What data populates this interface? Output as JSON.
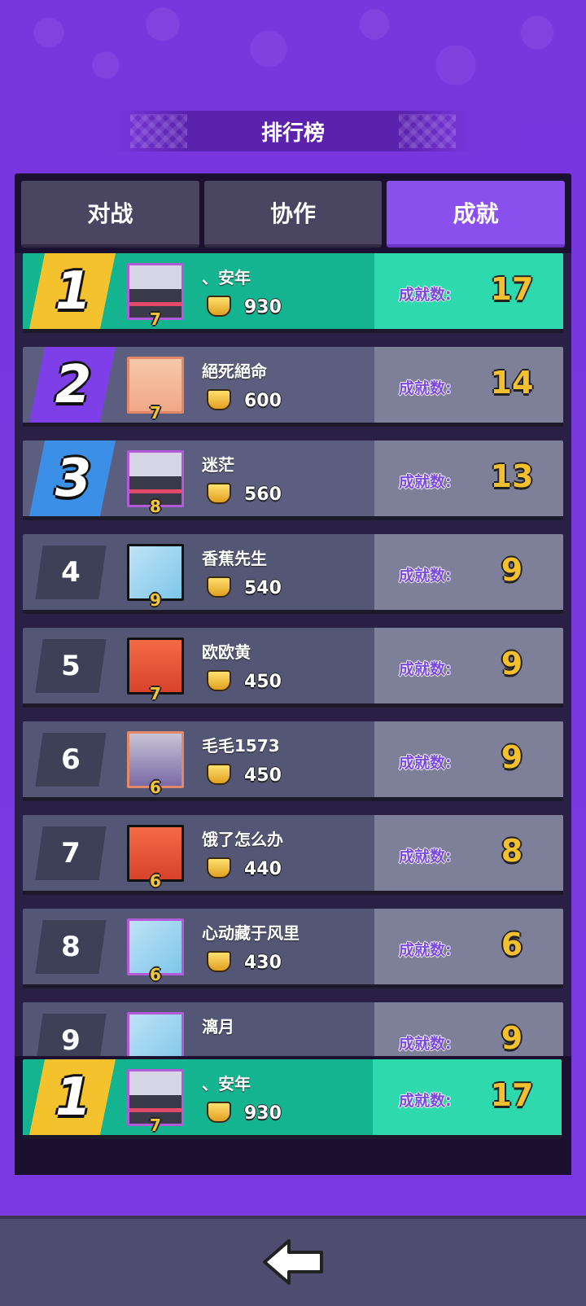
{
  "header": {
    "title": "排行榜"
  },
  "tabs": [
    {
      "label": "对战",
      "active": false
    },
    {
      "label": "协作",
      "active": false
    },
    {
      "label": "成就",
      "active": true
    }
  ],
  "achievement_label": "成就数:",
  "rows": [
    {
      "rank": "1",
      "name": "、安年",
      "level": "7",
      "score": "930",
      "achievements": "17",
      "avatar": "robot-avatar-icon"
    },
    {
      "rank": "2",
      "name": "絕死絕命",
      "level": "7",
      "score": "600",
      "achievements": "14",
      "avatar": "girl-avatar-icon"
    },
    {
      "rank": "3",
      "name": "迷茫",
      "level": "8",
      "score": "560",
      "achievements": "13",
      "avatar": "robot-avatar-icon"
    },
    {
      "rank": "4",
      "name": "香蕉先生",
      "level": "9",
      "score": "540",
      "achievements": "9",
      "avatar": "ice-avatar-icon"
    },
    {
      "rank": "5",
      "name": "欧欧黄",
      "level": "7",
      "score": "450",
      "achievements": "9",
      "avatar": "red-avatar-icon"
    },
    {
      "rank": "6",
      "name": "毛毛1573",
      "level": "6",
      "score": "450",
      "achievements": "9",
      "avatar": "grey-avatar-icon"
    },
    {
      "rank": "7",
      "name": "饿了怎么办",
      "level": "6",
      "score": "440",
      "achievements": "8",
      "avatar": "red-avatar-icon"
    },
    {
      "rank": "8",
      "name": "心动藏于风里",
      "level": "6",
      "score": "430",
      "achievements": "6",
      "avatar": "ice-avatar-icon"
    },
    {
      "rank": "9",
      "name": "漓月",
      "level": "",
      "score": "",
      "achievements": "9",
      "avatar": "ice-avatar-icon"
    }
  ],
  "my_row": {
    "rank": "1",
    "name": "、安年",
    "level": "7",
    "score": "930",
    "achievements": "17"
  },
  "footer": {
    "back_icon": "back-arrow-icon"
  },
  "colors": {
    "active_tab": "#8a50ee",
    "gold_row": "#13b48f",
    "value_yellow": "#f5c02e"
  }
}
